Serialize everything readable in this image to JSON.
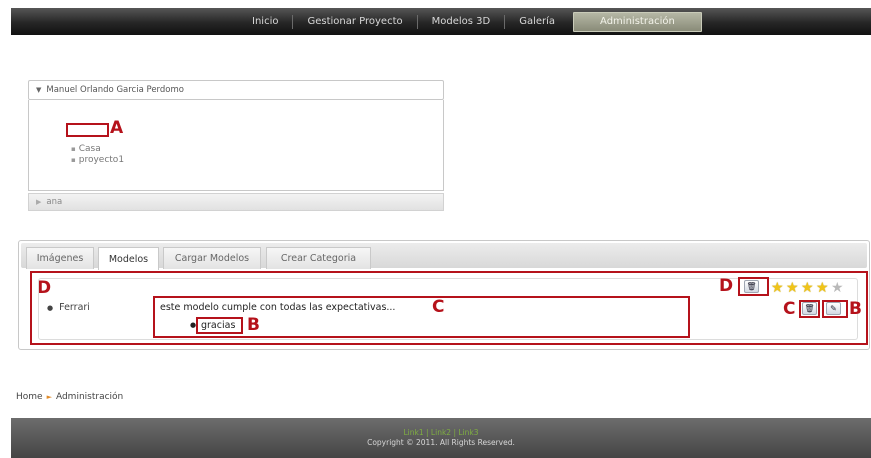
{
  "nav": {
    "items": [
      "Inicio",
      "Gestionar Proyecto",
      "Modelos 3D",
      "Galería",
      "Administración"
    ],
    "active": "Administración"
  },
  "accordion": {
    "user1": "Manuel Orlando Garcia Perdomo",
    "tree": [
      "Casa",
      "proyecto1"
    ],
    "user2": "ana"
  },
  "tabs": [
    "Imágenes",
    "Modelos",
    "Cargar Modelos",
    "Crear Categoria"
  ],
  "active_tab": "Modelos",
  "model": {
    "name": "Ferrari",
    "comment": "este modelo cumple con todas las expectativas...",
    "reply": "gracias",
    "rating": 4,
    "rating_max": 5
  },
  "annotations": {
    "a": "A",
    "b": "B",
    "c": "C",
    "d": "D"
  },
  "icons": {
    "delete": "trash-icon",
    "edit": "pencil-icon"
  },
  "breadcrumb": {
    "home": "Home",
    "current": "Administración"
  },
  "footer": {
    "links": "Link1 | Link2 | Link3",
    "copyright": "Copyright © 2011. All Rights Reserved."
  },
  "colors": {
    "annotation_red": "#b5121b",
    "link_green": "#7fae41",
    "star_gold": "#f0c419"
  }
}
